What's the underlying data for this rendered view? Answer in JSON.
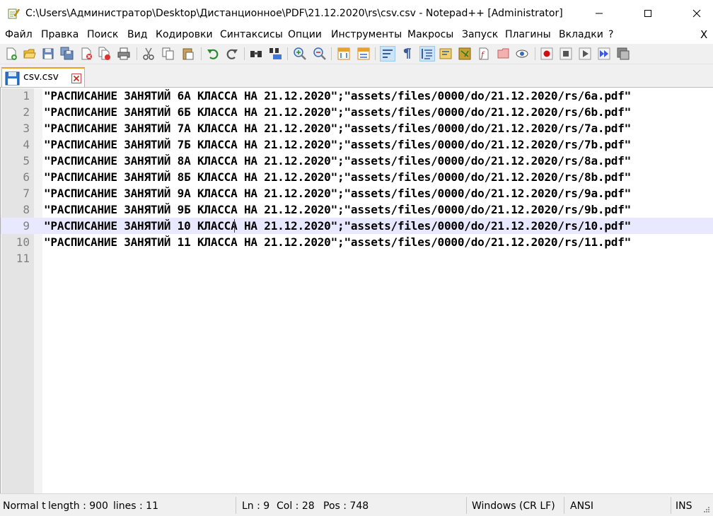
{
  "window": {
    "title": "C:\\Users\\Администратор\\Desktop\\Дистанционное\\PDF\\21.12.2020\\rs\\csv.csv - Notepad++ [Administrator]"
  },
  "menu": {
    "items": [
      "Файл",
      "Правка",
      "Поиск",
      "Вид",
      "Кодировки",
      "Синтаксисы",
      "Опции",
      "Инструменты",
      "Макросы",
      "Запуск",
      "Плагины",
      "Вкладки",
      "?"
    ],
    "close": "X"
  },
  "toolbar": {
    "icons": [
      "new-file-icon",
      "open-file-icon",
      "save-icon",
      "save-all-icon",
      "close-icon",
      "close-all-icon",
      "print-icon",
      "cut-icon",
      "copy-icon",
      "paste-icon",
      "undo-icon",
      "redo-icon",
      "find-icon",
      "replace-icon",
      "zoom-in-icon",
      "zoom-out-icon",
      "sync-vertical-icon",
      "sync-horizontal-icon",
      "word-wrap-icon",
      "show-all-chars-icon",
      "indent-guide-icon",
      "udl-icon",
      "doc-map-icon",
      "function-list-icon",
      "folder-workspace-icon",
      "monitoring-icon",
      "record-macro-icon",
      "stop-record-icon",
      "play-macro-icon",
      "run-macro-multiple-icon",
      "save-macro-icon"
    ]
  },
  "tab": {
    "label": "csv.csv"
  },
  "editor": {
    "current_line": 9,
    "lines": [
      {
        "n": "1",
        "text": "\"РАСПИСАНИЕ ЗАНЯТИЙ 6А КЛАССА НА 21.12.2020\";\"assets/files/0000/do/21.12.2020/rs/6a.pdf\""
      },
      {
        "n": "2",
        "text": "\"РАСПИСАНИЕ ЗАНЯТИЙ 6Б КЛАССА НА 21.12.2020\";\"assets/files/0000/do/21.12.2020/rs/6b.pdf\""
      },
      {
        "n": "3",
        "text": "\"РАСПИСАНИЕ ЗАНЯТИЙ 7А КЛАССА НА 21.12.2020\";\"assets/files/0000/do/21.12.2020/rs/7a.pdf\""
      },
      {
        "n": "4",
        "text": "\"РАСПИСАНИЕ ЗАНЯТИЙ 7Б КЛАССА НА 21.12.2020\";\"assets/files/0000/do/21.12.2020/rs/7b.pdf\""
      },
      {
        "n": "5",
        "text": "\"РАСПИСАНИЕ ЗАНЯТИЙ 8А КЛАССА НА 21.12.2020\";\"assets/files/0000/do/21.12.2020/rs/8a.pdf\""
      },
      {
        "n": "6",
        "text": "\"РАСПИСАНИЕ ЗАНЯТИЙ 8Б КЛАССА НА 21.12.2020\";\"assets/files/0000/do/21.12.2020/rs/8b.pdf\""
      },
      {
        "n": "7",
        "text": "\"РАСПИСАНИЕ ЗАНЯТИЙ 9А КЛАССА НА 21.12.2020\";\"assets/files/0000/do/21.12.2020/rs/9a.pdf\""
      },
      {
        "n": "8",
        "text": "\"РАСПИСАНИЕ ЗАНЯТИЙ 9Б КЛАССА НА 21.12.2020\";\"assets/files/0000/do/21.12.2020/rs/9b.pdf\""
      },
      {
        "n": "9",
        "text": "\"РАСПИСАНИЕ ЗАНЯТИЙ 10 КЛАССА НА 21.12.2020\";\"assets/files/0000/do/21.12.2020/rs/10.pdf\""
      },
      {
        "n": "10",
        "text": "\"РАСПИСАНИЕ ЗАНЯТИЙ 11 КЛАССА НА 21.12.2020\";\"assets/files/0000/do/21.12.2020/rs/11.pdf\""
      },
      {
        "n": "11",
        "text": ""
      }
    ]
  },
  "status": {
    "doc_type": "Normal t",
    "length": "length : 900",
    "lines": "lines : 11",
    "ln": "Ln : 9",
    "col": "Col : 28",
    "pos": "Pos : 748",
    "eol": "Windows (CR LF)",
    "encoding": "ANSI",
    "mode": "INS"
  }
}
